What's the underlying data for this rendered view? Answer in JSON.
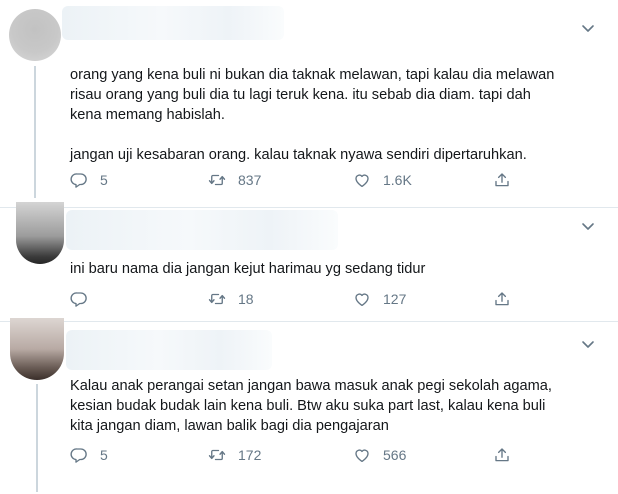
{
  "tweets": [
    {
      "text": "orang yang kena buli ni bukan dia taknak melawan, tapi kalau dia melawan\nrisau orang yang buli dia tu lagi teruk kena. itu sebab dia diam. tapi dah\nkena memang habislah.\n\njangan uji kesabaran orang. kalau taknak nyawa sendiri dipertaruhkan.",
      "replies": "5",
      "retweets": "837",
      "likes": "1.6K"
    },
    {
      "text": "ini baru nama dia jangan kejut harimau yg sedang tidur",
      "replies": "",
      "retweets": "18",
      "likes": "127"
    },
    {
      "text": "Kalau anak perangai setan jangan bawa masuk anak pegi sekolah agama,\nkesian budak budak lain kena buli. Btw aku suka part last, kalau kena buli\nkita jangan diam, lawan balik bagi dia pengajaran",
      "replies": "5",
      "retweets": "172",
      "likes": "566"
    }
  ],
  "icons": [
    "chevron-down-icon",
    "reply-icon",
    "retweet-icon",
    "like-icon",
    "share-icon"
  ],
  "colors": {
    "muted": "#657786",
    "divider": "#e1e8ed",
    "thread": "#ccd6dd",
    "text": "#14171a"
  }
}
